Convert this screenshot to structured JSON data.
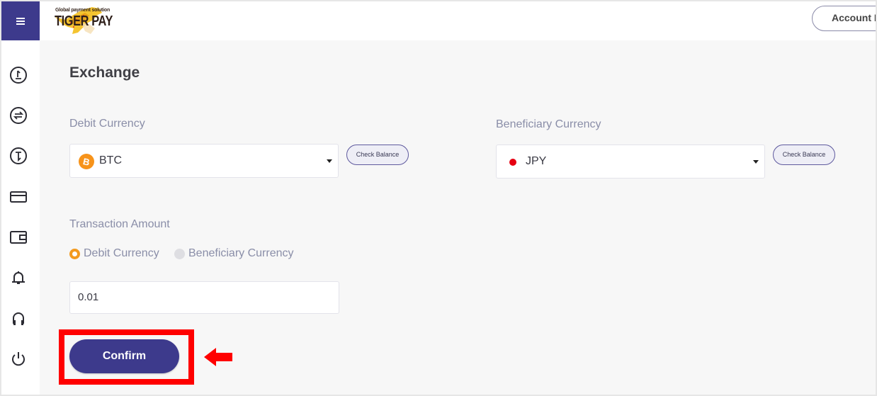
{
  "header": {
    "menu_icon": "hamburger-icon",
    "logo_tagline": "Global payment solution",
    "logo_name": "TIGER PAY",
    "account_button": "Account M"
  },
  "sidebar": {
    "items": [
      {
        "icon": "deposit-icon"
      },
      {
        "icon": "exchange-icon"
      },
      {
        "icon": "withdraw-icon"
      },
      {
        "icon": "card-icon"
      },
      {
        "icon": "wallet-icon"
      },
      {
        "icon": "bell-icon"
      },
      {
        "icon": "headset-icon"
      },
      {
        "icon": "power-icon"
      }
    ]
  },
  "main": {
    "title": "Exchange",
    "debit": {
      "label": "Debit Currency",
      "selected": "BTC",
      "icon": "bitcoin-icon",
      "icon_color": "#f7931a",
      "check_balance": "Check Balance"
    },
    "beneficiary": {
      "label": "Beneficiary Currency",
      "selected": "JPY",
      "icon": "japan-flag-icon",
      "icon_color": "#e60012",
      "check_balance": "Check Balance"
    },
    "amount": {
      "label": "Transaction Amount",
      "options": [
        {
          "label": "Debit Currency",
          "selected": true
        },
        {
          "label": "Beneficiary Currency",
          "selected": false
        }
      ],
      "value": "0.01"
    },
    "confirm_label": "Confirm"
  },
  "annotation": {
    "highlight_color": "#ff0000",
    "arrow": "left-arrow"
  },
  "colors": {
    "brand": "#3d3a8c",
    "accent": "#f39a1e"
  }
}
